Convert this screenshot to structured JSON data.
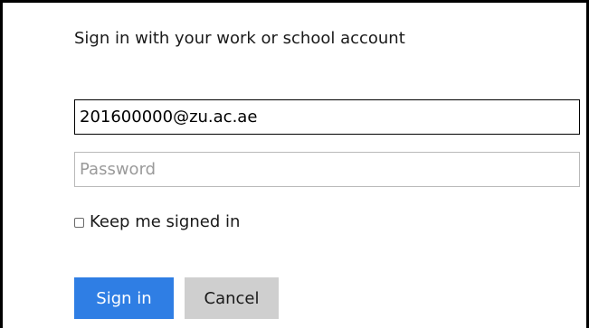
{
  "signin": {
    "title": "Sign in with your work or school account",
    "username_value": "201600000@zu.ac.ae",
    "password_value": "",
    "password_placeholder": "Password",
    "keep_signed_in_label": "Keep me signed in",
    "keep_signed_in_checked": false,
    "sign_in_label": "Sign in",
    "cancel_label": "Cancel"
  },
  "colors": {
    "primary_button": "#2f7ee4",
    "secondary_button": "#cfcfcf",
    "border": "#000000"
  }
}
